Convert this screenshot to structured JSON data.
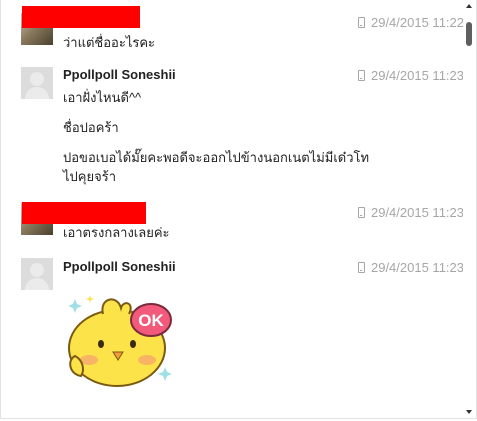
{
  "messages": [
    {
      "sender": "",
      "sender_redacted": true,
      "timestamp": "29/4/2015 11:22",
      "lines": [
        "ว่าแต่ชื่ออะไรคะ"
      ]
    },
    {
      "sender": "Ppollpoll Soneshii",
      "sender_redacted": false,
      "timestamp": "29/4/2015 11:23",
      "lines": [
        "เอาฝั่งไหนดี^^",
        "ชื่อปอคร้า",
        "ปอขอเบอได้มั๊ยคะพอดีจะออกไปข้างนอกเนตไม่มีเด๋วโท",
        "ไปคุยจร้า"
      ]
    },
    {
      "sender": "",
      "sender_redacted": true,
      "timestamp": "29/4/2015 11:23",
      "lines": [
        "เอาตรงกลางเลยค่ะ"
      ]
    },
    {
      "sender": "Ppollpoll Soneshii",
      "sender_redacted": false,
      "timestamp": "29/4/2015 11:23",
      "sticker": {
        "name": "ok-chick-sticker",
        "badge_text": "OK"
      }
    }
  ],
  "colors": {
    "redaction": "#ff0000",
    "timestamp": "#a6a6a6",
    "avatar_placeholder": "#dcdcdc",
    "sticker_body": "#fde34a",
    "sticker_badge": "#f25a7b"
  },
  "icons": {
    "timestamp_device": "mobile-phone-icon"
  }
}
